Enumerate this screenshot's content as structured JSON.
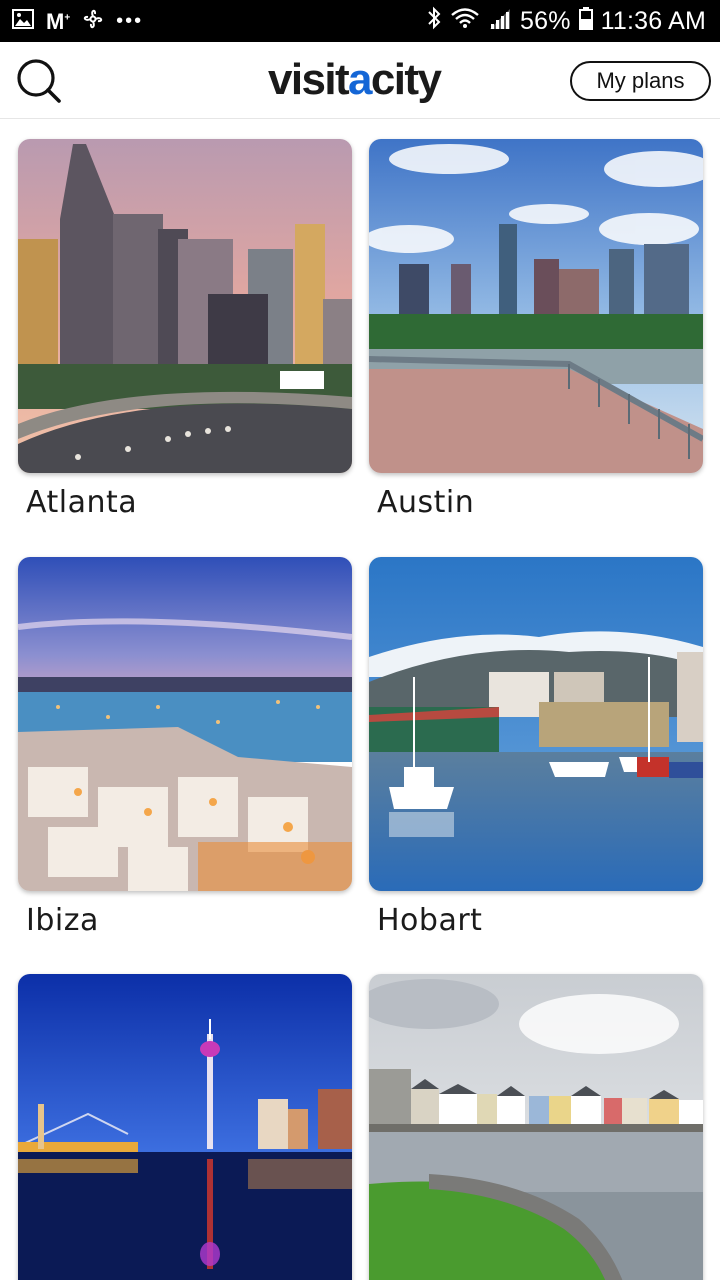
{
  "status_bar": {
    "battery": "56%",
    "time": "11:36 AM",
    "left_icons": [
      "gallery-icon",
      "gmail-icon",
      "fan-icon",
      "more-icon"
    ],
    "right_icons": [
      "bluetooth-icon",
      "wifi-icon",
      "signal-icon",
      "battery-icon"
    ]
  },
  "header": {
    "logo_part1": "visit",
    "logo_part2": "a",
    "logo_part3": "city",
    "my_plans_label": "My plans",
    "accent": "#1466d6"
  },
  "cities": [
    {
      "name": "Atlanta"
    },
    {
      "name": "Austin"
    },
    {
      "name": "Ibiza"
    },
    {
      "name": "Hobart"
    },
    {
      "name": ""
    },
    {
      "name": ""
    }
  ]
}
